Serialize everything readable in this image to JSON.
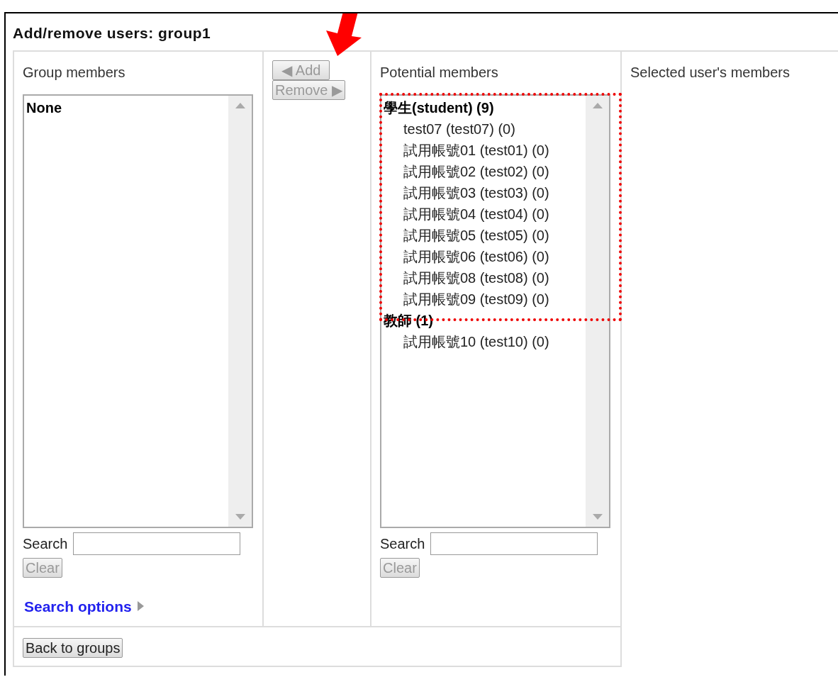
{
  "title": "Add/remove users: group1",
  "group_members": {
    "heading": "Group members",
    "options": [
      {
        "kind": "group",
        "label": "None"
      }
    ],
    "search_label": "Search",
    "clear_button": {
      "label": "Clear",
      "disabled": true
    },
    "search_options_link": "Search options"
  },
  "action_buttons": [
    {
      "label": "◀ Add",
      "disabled": true
    },
    {
      "label": "Remove ▶",
      "disabled": true
    }
  ],
  "potential_members": {
    "heading": "Potential members",
    "options": [
      {
        "kind": "group",
        "label": "學生(student) (9)",
        "children": [
          {
            "label": "test07 (test07) (0)"
          },
          {
            "label": "試用帳號01 (test01) (0)"
          },
          {
            "label": "試用帳號02 (test02) (0)"
          },
          {
            "label": "試用帳號03 (test03) (0)"
          },
          {
            "label": "試用帳號04 (test04) (0)"
          },
          {
            "label": "試用帳號05 (test05) (0)"
          },
          {
            "label": "試用帳號06 (test06) (0)"
          },
          {
            "label": "試用帳號08 (test08) (0)"
          },
          {
            "label": "試用帳號09 (test09) (0)"
          }
        ]
      },
      {
        "kind": "group",
        "label": "教師 (1)",
        "children": [
          {
            "label": "試用帳號10 (test10) (0)"
          }
        ]
      }
    ],
    "search_label": "Search",
    "clear_button": {
      "label": "Clear",
      "disabled": true
    }
  },
  "selected_membership": {
    "heading": "Selected user's members"
  },
  "back_button": {
    "label": "Back to groups",
    "disabled": false
  },
  "annotations": [
    {
      "kind": "arrow"
    },
    {
      "kind": "highlight-box"
    }
  ]
}
